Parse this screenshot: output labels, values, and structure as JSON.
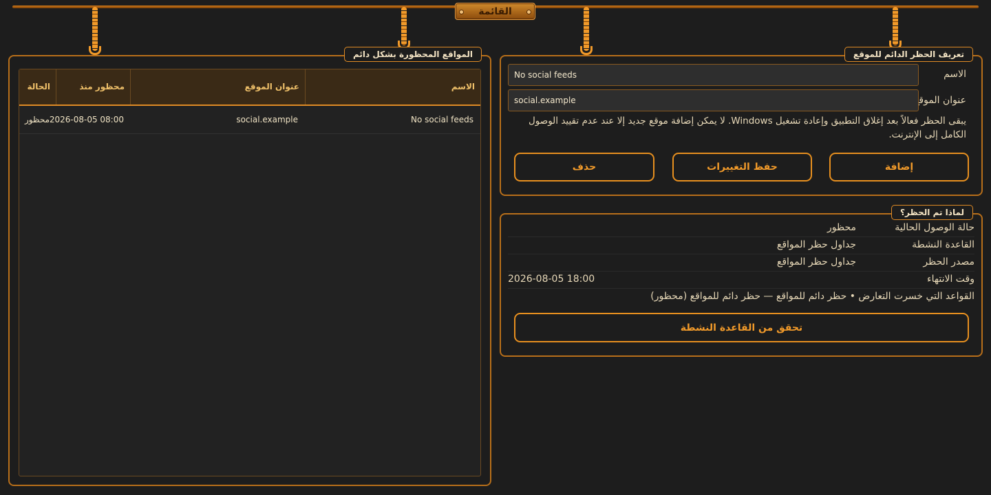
{
  "menu": {
    "label": "القائمة"
  },
  "blocked_panel": {
    "title": "المواقع المحظورة بشكل دائم",
    "columns": [
      "الاسم",
      "عنوان الموقع",
      "محظور منذ",
      "الحالة"
    ],
    "rows": [
      {
        "name": "No social feeds",
        "url": "social.example",
        "since": "2026-08-05 08:00",
        "status": "محظور"
      }
    ]
  },
  "form_panel": {
    "title": "تعريف الحظر الدائم للموقع",
    "name_label": "الاسم",
    "name_value": "No social feeds",
    "url_label": "عنوان الموقع",
    "url_value": "social.example",
    "note": "يبقى الحظر فعالاً بعد إغلاق التطبيق وإعادة تشغيل Windows. لا يمكن إضافة موقع جديد إلا عند عدم تقييد الوصول الكامل إلى الإنترنت.",
    "add_label": "إضافة",
    "save_label": "حفظ التغييرات",
    "delete_label": "حذف"
  },
  "why_panel": {
    "title": "لماذا تم الحظر؟",
    "access_label": "حالة الوصول الحالية",
    "access_value": "محظور",
    "rule_label": "القاعدة النشطة",
    "rule_value": "جداول حظر المواقع",
    "source_label": "مصدر الحظر",
    "source_value": "جداول حظر المواقع",
    "expiry_label": "وقت الانتهاء",
    "expiry_value": "2026-08-05 18:00",
    "conflict_text": "القواعد التي خسرت التعارض • حظر دائم للمواقع — حظر دائم للمواقع (محظور)",
    "check_label": "تحقق من القاعدة النشطة"
  },
  "colors": {
    "accent": "#e8901f",
    "background": "#1d1d1d",
    "header": "#3a2a16"
  }
}
